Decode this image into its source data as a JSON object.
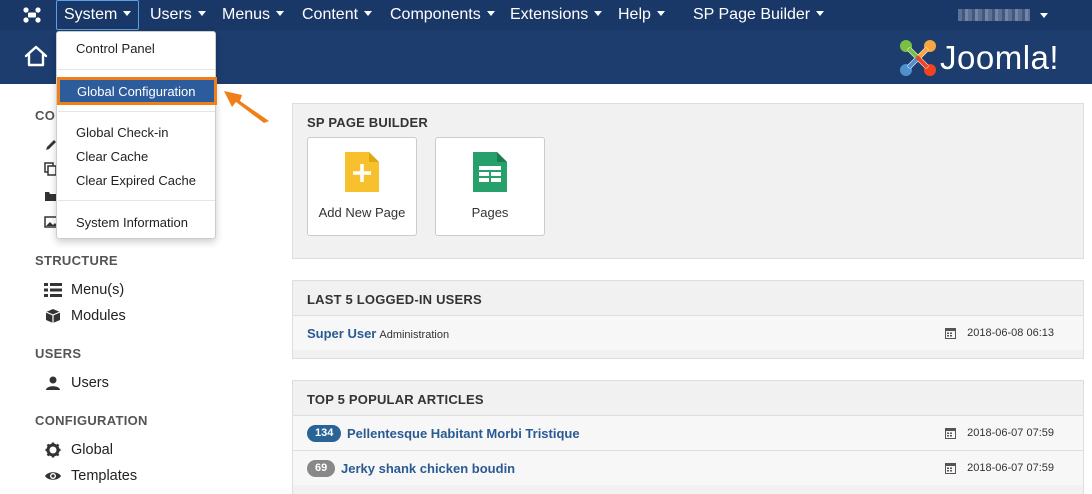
{
  "topbar": {
    "menus": [
      "System",
      "Users",
      "Menus",
      "Content",
      "Components",
      "Extensions",
      "Help",
      "SP Page Builder"
    ],
    "active_menu": "System"
  },
  "header": {
    "brand": "Joomla!"
  },
  "system_dropdown": {
    "items": [
      "Control Panel",
      "Global Configuration",
      "Global Check-in",
      "Clear Cache",
      "Clear Expired Cache",
      "System Information"
    ],
    "highlighted": "Global Configuration"
  },
  "sidebar": {
    "partial_head": "CO",
    "sections": [
      {
        "title": "STRUCTURE",
        "links": [
          "Menu(s)",
          "Modules"
        ]
      },
      {
        "title": "USERS",
        "links": [
          "Users"
        ]
      },
      {
        "title": "CONFIGURATION",
        "links": [
          "Global",
          "Templates"
        ]
      }
    ]
  },
  "sp_page_builder": {
    "title": "SP PAGE BUILDER",
    "tiles": [
      "Add New Page",
      "Pages"
    ]
  },
  "logged_in": {
    "title": "LAST 5 LOGGED-IN USERS",
    "rows": [
      {
        "name": "Super User",
        "role": "Administration",
        "date": "2018-06-08 06:13"
      }
    ]
  },
  "popular": {
    "title": "TOP 5 POPULAR ARTICLES",
    "rows": [
      {
        "hits": "134",
        "title": "Pellentesque Habitant Morbi Tristique",
        "date": "2018-06-07 07:59",
        "badge_color": "#2a6496"
      },
      {
        "hits": "69",
        "title": "Jerky shank chicken boudin",
        "date": "2018-06-07 07:59",
        "badge_color": "#888888"
      }
    ]
  },
  "colors": {
    "navbar": "#1a3867",
    "header": "#1c3d6e",
    "highlight_border": "#f07f1a",
    "link": "#2a5a94"
  }
}
